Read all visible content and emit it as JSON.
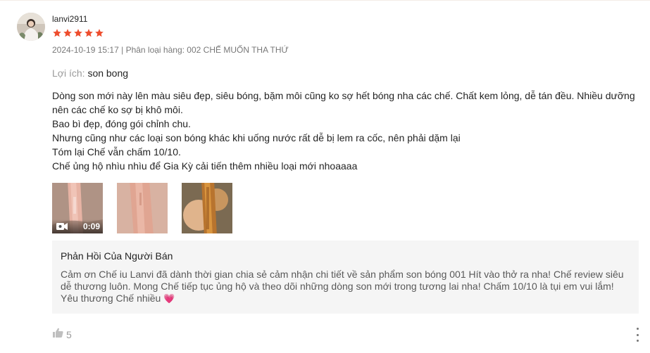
{
  "review": {
    "username": "lanvi2911",
    "rating": 5,
    "star_color": "#ee4d2d",
    "date": "2024-10-19 15:17",
    "separator": "|",
    "variation": "Phân loại hàng: 002 CHẾ MUỐN THA THỨ",
    "benefit_label": "Lợi ích:",
    "benefit_value": "son bong",
    "content_lines": [
      "Dòng son mới này lên màu siêu đẹp, siêu bóng, bặm môi cũng ko sợ hết bóng nha các chế. Chất kem lỏng, dễ tán đều. Nhiều dưỡng nên các chế ko sợ bị khô môi.",
      "Bao bì đẹp, đóng gói chỉnh chu.",
      "Nhưng cũng như các loại son bóng khác khi uống nước rất dễ bị lem ra cốc, nên phải dặm lại",
      "Tóm lại Chế vẫn chấm 10/10.",
      "Chế ủng hộ nhìu nhìu để Gia Kỳ cải tiến thêm nhiều loại mới nhoaaaa"
    ],
    "media": {
      "video_duration": "0:09",
      "image_count": 2
    },
    "seller_reply": {
      "title": "Phản Hồi Của Người Bán",
      "text": "Cảm ơn Chế iu Lanvi đã dành thời gian chia sẻ cảm nhận chi tiết về sản phẩm son bóng 001 Hít vào thở ra nha! Chế review siêu dễ thương luôn. Mong Chế tiếp tục ủng hộ và theo dõi những dòng son mới trong tương lai nha! Chấm 10/10 là tụi em vui lắm! Yêu thương Chế nhiều",
      "emoji": "💗"
    },
    "likes": "5"
  }
}
